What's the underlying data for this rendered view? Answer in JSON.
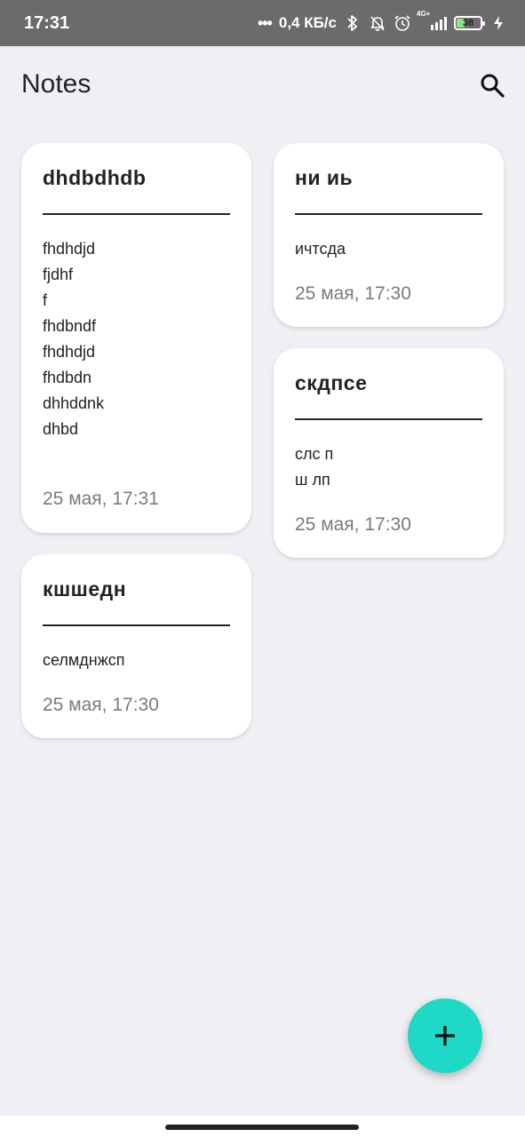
{
  "status_bar": {
    "time": "17:31",
    "network_speed": "0,4 КБ/с",
    "signal_label": "4G+",
    "battery_level": "38",
    "battery_percent": 38,
    "icons": [
      "dots-icon",
      "bluetooth-icon",
      "bell-off-icon",
      "alarm-icon",
      "signal-icon",
      "battery-icon",
      "charging-icon"
    ]
  },
  "header": {
    "title": "Notes",
    "search_icon": "search-icon"
  },
  "notes": [
    {
      "title": "dhdbdhdb",
      "body": "fhdhdjd\nfjdhf\nf\nfhdbndf\nfhdhdjd\nfhdbdn\ndhhddnk\ndhbd",
      "date": "25 мая, 17:31"
    },
    {
      "title": "ни иь",
      "body": "ичтсда",
      "date": "25 мая, 17:30"
    },
    {
      "title": "скдпсе",
      "body": "слс п\nш лп",
      "date": "25 мая, 17:30"
    },
    {
      "title": "кшшедн",
      "body": "селмднжсп",
      "date": "25 мая, 17:30"
    }
  ],
  "fab": {
    "icon": "plus-icon",
    "color": "#1dd9c6"
  },
  "colors": {
    "background": "#efeff4",
    "status_bar": "#6b6b6b",
    "card": "#ffffff",
    "accent": "#1dd9c6",
    "date_text": "#7a7a7a"
  }
}
